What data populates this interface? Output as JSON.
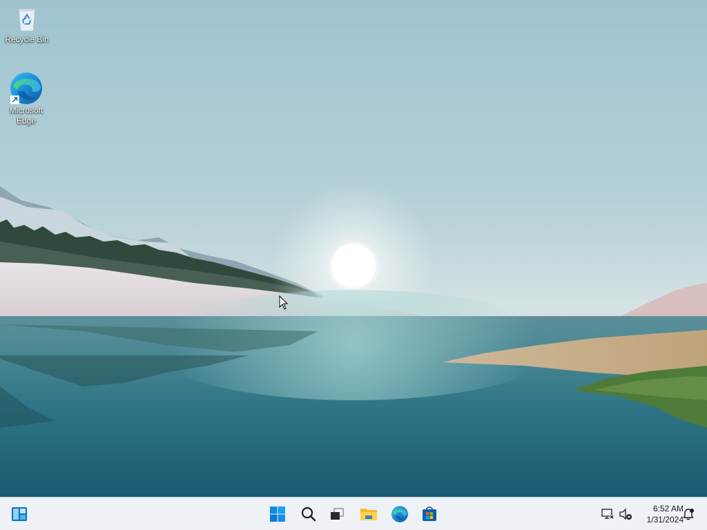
{
  "desktop": {
    "icons": [
      {
        "label": "Recycle Bin",
        "icon": "recycle-bin-icon"
      },
      {
        "label": "Microsoft Edge",
        "icon": "edge-icon"
      }
    ]
  },
  "taskbar": {
    "left": [
      {
        "icon": "widgets-icon"
      }
    ],
    "center": [
      {
        "icon": "start-icon"
      },
      {
        "icon": "search-icon"
      },
      {
        "icon": "task-view-icon"
      },
      {
        "icon": "file-explorer-icon"
      },
      {
        "icon": "edge-icon"
      },
      {
        "icon": "microsoft-store-icon"
      }
    ],
    "tray": [
      {
        "icon": "network-icon"
      },
      {
        "icon": "volume-muted-icon"
      }
    ],
    "clock": {
      "time": "6:52 AM",
      "date": "1/31/2024"
    },
    "notification": {
      "icon": "notification-icon"
    }
  },
  "colors": {
    "taskbar_bg": "#eef1f5",
    "windows_blue": "#0078d4"
  }
}
